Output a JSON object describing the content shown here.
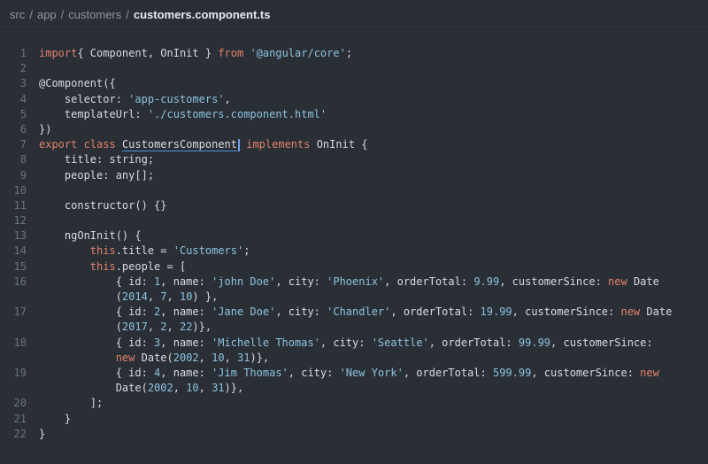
{
  "breadcrumb": {
    "items": [
      "src",
      "app",
      "customers"
    ],
    "current": "customers.component.ts",
    "separator": "/"
  },
  "editor": {
    "lines": [
      {
        "n": "1",
        "segments": [
          [
            "kw",
            "import"
          ],
          [
            "",
            "{ Component, OnInit } "
          ],
          [
            "kw",
            "from"
          ],
          [
            "",
            ""
          ],
          [
            "str",
            " '@angular/core'"
          ],
          [
            "",
            ";"
          ]
        ]
      },
      {
        "n": "2",
        "segments": [
          [
            "",
            ""
          ]
        ]
      },
      {
        "n": "3",
        "segments": [
          [
            "",
            "@Component({"
          ]
        ]
      },
      {
        "n": "4",
        "segments": [
          [
            "",
            "    selector: "
          ],
          [
            "str",
            "'app-customers'"
          ],
          [
            "",
            ","
          ]
        ]
      },
      {
        "n": "5",
        "segments": [
          [
            "",
            "    templateUrl: "
          ],
          [
            "str",
            "'./customers.component.html'"
          ]
        ]
      },
      {
        "n": "6",
        "segments": [
          [
            "",
            "})"
          ]
        ]
      },
      {
        "n": "7",
        "segments": [
          [
            "kw",
            "export"
          ],
          [
            "",
            " "
          ],
          [
            "kw",
            "class"
          ],
          [
            "",
            " "
          ],
          [
            "cursor",
            "CustomersComponent"
          ],
          [
            "caret",
            ""
          ],
          [
            "",
            " "
          ],
          [
            "kw",
            "implements"
          ],
          [
            "",
            " OnInit {"
          ]
        ]
      },
      {
        "n": "8",
        "segments": [
          [
            "",
            "    title: string;"
          ]
        ]
      },
      {
        "n": "9",
        "segments": [
          [
            "",
            "    people: any[];"
          ]
        ]
      },
      {
        "n": "10",
        "segments": [
          [
            "",
            ""
          ]
        ]
      },
      {
        "n": "11",
        "segments": [
          [
            "",
            "    constructor() {}"
          ]
        ]
      },
      {
        "n": "12",
        "segments": [
          [
            "",
            ""
          ]
        ]
      },
      {
        "n": "13",
        "segments": [
          [
            "",
            "    ngOnInit() {"
          ]
        ]
      },
      {
        "n": "14",
        "segments": [
          [
            "",
            "        "
          ],
          [
            "kw",
            "this"
          ],
          [
            "",
            ".title = "
          ],
          [
            "str",
            "'Customers'"
          ],
          [
            "",
            ";"
          ]
        ]
      },
      {
        "n": "15",
        "segments": [
          [
            "",
            "        "
          ],
          [
            "kw",
            "this"
          ],
          [
            "",
            ".people = ["
          ]
        ]
      },
      {
        "n": "16",
        "segments": [
          [
            "",
            "            { id: "
          ],
          [
            "num",
            "1"
          ],
          [
            "",
            ", name: "
          ],
          [
            "str",
            "'john Doe'"
          ],
          [
            "",
            ", city: "
          ],
          [
            "str",
            "'Phoenix'"
          ],
          [
            "",
            ", orderTotal: "
          ],
          [
            "num",
            "9.99"
          ],
          [
            "",
            ", customerSince: "
          ],
          [
            "kw",
            "new"
          ],
          [
            "",
            " Date"
          ]
        ]
      },
      {
        "n": "",
        "segments": [
          [
            "",
            "            ("
          ],
          [
            "num",
            "2014"
          ],
          [
            "",
            ", "
          ],
          [
            "num",
            "7"
          ],
          [
            "",
            ", "
          ],
          [
            "num",
            "10"
          ],
          [
            "",
            ") },"
          ]
        ]
      },
      {
        "n": "17",
        "segments": [
          [
            "",
            "            { id: "
          ],
          [
            "num",
            "2"
          ],
          [
            "",
            ", name: "
          ],
          [
            "str",
            "'Jane Doe'"
          ],
          [
            "",
            ", city: "
          ],
          [
            "str",
            "'Chandler'"
          ],
          [
            "",
            ", orderTotal: "
          ],
          [
            "num",
            "19.99"
          ],
          [
            "",
            ", customerSince: "
          ],
          [
            "kw",
            "new"
          ],
          [
            "",
            " Date"
          ]
        ]
      },
      {
        "n": "",
        "segments": [
          [
            "",
            "            ("
          ],
          [
            "num",
            "2017"
          ],
          [
            "",
            ", "
          ],
          [
            "num",
            "2"
          ],
          [
            "",
            ", "
          ],
          [
            "num",
            "22"
          ],
          [
            "",
            ")},"
          ]
        ]
      },
      {
        "n": "18",
        "segments": [
          [
            "",
            "            { id: "
          ],
          [
            "num",
            "3"
          ],
          [
            "",
            ", name: "
          ],
          [
            "str",
            "'Michelle Thomas'"
          ],
          [
            "",
            ", city: "
          ],
          [
            "str",
            "'Seattle'"
          ],
          [
            "",
            ", orderTotal: "
          ],
          [
            "num",
            "99.99"
          ],
          [
            "",
            ", customerSince:"
          ]
        ]
      },
      {
        "n": "",
        "segments": [
          [
            "",
            "            "
          ],
          [
            "kw",
            "new"
          ],
          [
            "",
            " Date("
          ],
          [
            "num",
            "2002"
          ],
          [
            "",
            ", "
          ],
          [
            "num",
            "10"
          ],
          [
            "",
            ", "
          ],
          [
            "num",
            "31"
          ],
          [
            "",
            ")},"
          ]
        ]
      },
      {
        "n": "19",
        "segments": [
          [
            "",
            "            { id: "
          ],
          [
            "num",
            "4"
          ],
          [
            "",
            ", name: "
          ],
          [
            "str",
            "'Jim Thomas'"
          ],
          [
            "",
            ", city: "
          ],
          [
            "str",
            "'New York'"
          ],
          [
            "",
            ", orderTotal: "
          ],
          [
            "num",
            "599.99"
          ],
          [
            "",
            ", customerSince: "
          ],
          [
            "kw",
            "new"
          ]
        ]
      },
      {
        "n": "",
        "segments": [
          [
            "",
            "            Date("
          ],
          [
            "num",
            "2002"
          ],
          [
            "",
            ", "
          ],
          [
            "num",
            "10"
          ],
          [
            "",
            ", "
          ],
          [
            "num",
            "31"
          ],
          [
            "",
            ")},"
          ]
        ]
      },
      {
        "n": "20",
        "segments": [
          [
            "",
            "        ];"
          ]
        ]
      },
      {
        "n": "21",
        "segments": [
          [
            "",
            "    }"
          ]
        ]
      },
      {
        "n": "22",
        "segments": [
          [
            "",
            "}"
          ]
        ]
      }
    ]
  }
}
